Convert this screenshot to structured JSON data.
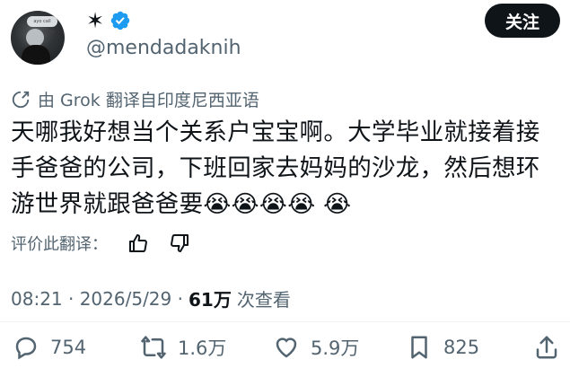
{
  "user": {
    "display_name": "✶",
    "handle": "@mendadaknih",
    "avatar_caption": "ayo call rebersenjos"
  },
  "follow_label": "关注",
  "translation_note": "由 Grok 翻译自印度尼西亚语",
  "tweet": {
    "text": "天哪我好想当个关系户宝宝啊。大学毕业就接着接\n手爸爸的公司，下班回家去妈妈的沙龙，然后想环\n游世界就跟爸爸要😭😭😭😭 😭"
  },
  "rate_translation_label": "评价此翻译：",
  "meta": {
    "time_date": "08:21 · 2026/5/29 ·",
    "views_count": "61万",
    "views_label": "次查看"
  },
  "actions": {
    "replies": "754",
    "reposts": "1.6万",
    "likes": "5.9万",
    "bookmarks": "825"
  },
  "colors": {
    "text": "#0f1419",
    "secondary": "#536471",
    "verified": "#1d9bf0"
  }
}
